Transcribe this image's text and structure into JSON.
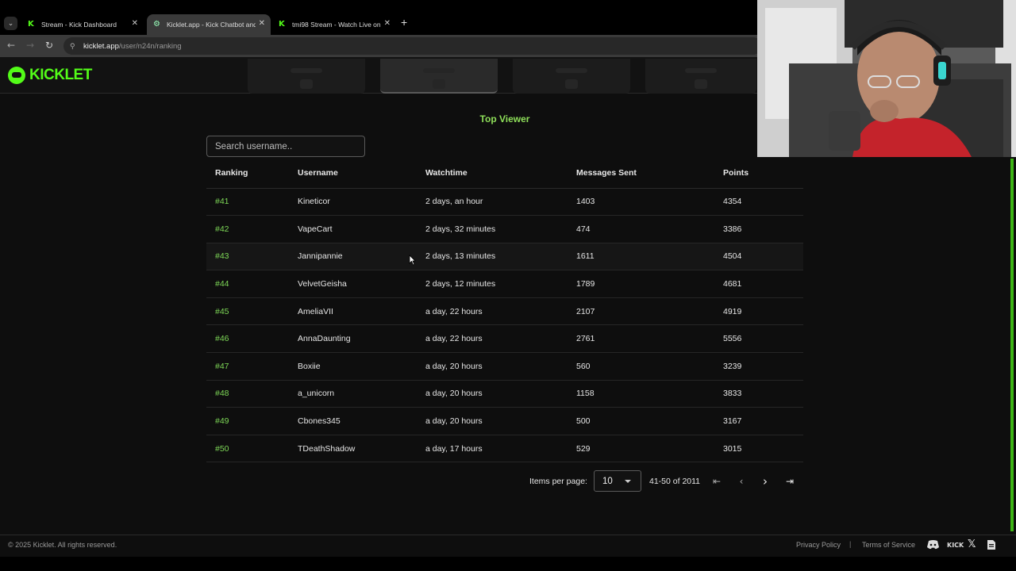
{
  "browser": {
    "tabs": [
      {
        "title": "Stream - Kick Dashboard",
        "favicon": "kick-icon",
        "active": false
      },
      {
        "title": "Kicklet.app - Kick Chatbot and",
        "favicon": "kicklet-icon",
        "active": true
      },
      {
        "title": "tmi98 Stream - Watch Live on",
        "favicon": "kick-icon",
        "active": false
      }
    ],
    "url_host": "kicklet.app",
    "url_path": "/user/n24n/ranking"
  },
  "header": {
    "logo_text": "KICKLET"
  },
  "main": {
    "section_title": "Top Viewer",
    "search_placeholder": "Search username..",
    "columns": [
      "Ranking",
      "Username",
      "Watchtime",
      "Messages Sent",
      "Points"
    ],
    "rows": [
      {
        "rank": "#41",
        "username": "Kineticor",
        "watchtime": "2 days, an hour",
        "messages": "1403",
        "points": "4354"
      },
      {
        "rank": "#42",
        "username": "VapeCart",
        "watchtime": "2 days, 32 minutes",
        "messages": "474",
        "points": "3386"
      },
      {
        "rank": "#43",
        "username": "Jannipannie",
        "watchtime": "2 days, 13 minutes",
        "messages": "1611",
        "points": "4504"
      },
      {
        "rank": "#44",
        "username": "VelvetGeisha",
        "watchtime": "2 days, 12 minutes",
        "messages": "1789",
        "points": "4681"
      },
      {
        "rank": "#45",
        "username": "AmeliaVII",
        "watchtime": "a day, 22 hours",
        "messages": "2107",
        "points": "4919"
      },
      {
        "rank": "#46",
        "username": "AnnaDaunting",
        "watchtime": "a day, 22 hours",
        "messages": "2761",
        "points": "5556"
      },
      {
        "rank": "#47",
        "username": "Boxiie",
        "watchtime": "a day, 20 hours",
        "messages": "560",
        "points": "3239"
      },
      {
        "rank": "#48",
        "username": "a_unicorn",
        "watchtime": "a day, 20 hours",
        "messages": "1158",
        "points": "3833"
      },
      {
        "rank": "#49",
        "username": "Cbones345",
        "watchtime": "a day, 20 hours",
        "messages": "500",
        "points": "3167"
      },
      {
        "rank": "#50",
        "username": "TDeathShadow",
        "watchtime": "a day, 17 hours",
        "messages": "529",
        "points": "3015"
      }
    ],
    "pagination": {
      "items_per_page_label": "Items per page:",
      "items_per_page_value": "10",
      "range_text": "41-50 of 2011"
    }
  },
  "footer": {
    "copyright": "© 2025 Kicklet. All rights reserved.",
    "privacy": "Privacy Policy",
    "separator": "|",
    "terms": "Terms of Service",
    "kick_label": "KICK"
  },
  "colors": {
    "accent": "#53fc18",
    "rank_green": "#7ed957",
    "background": "#0e0e0e"
  }
}
